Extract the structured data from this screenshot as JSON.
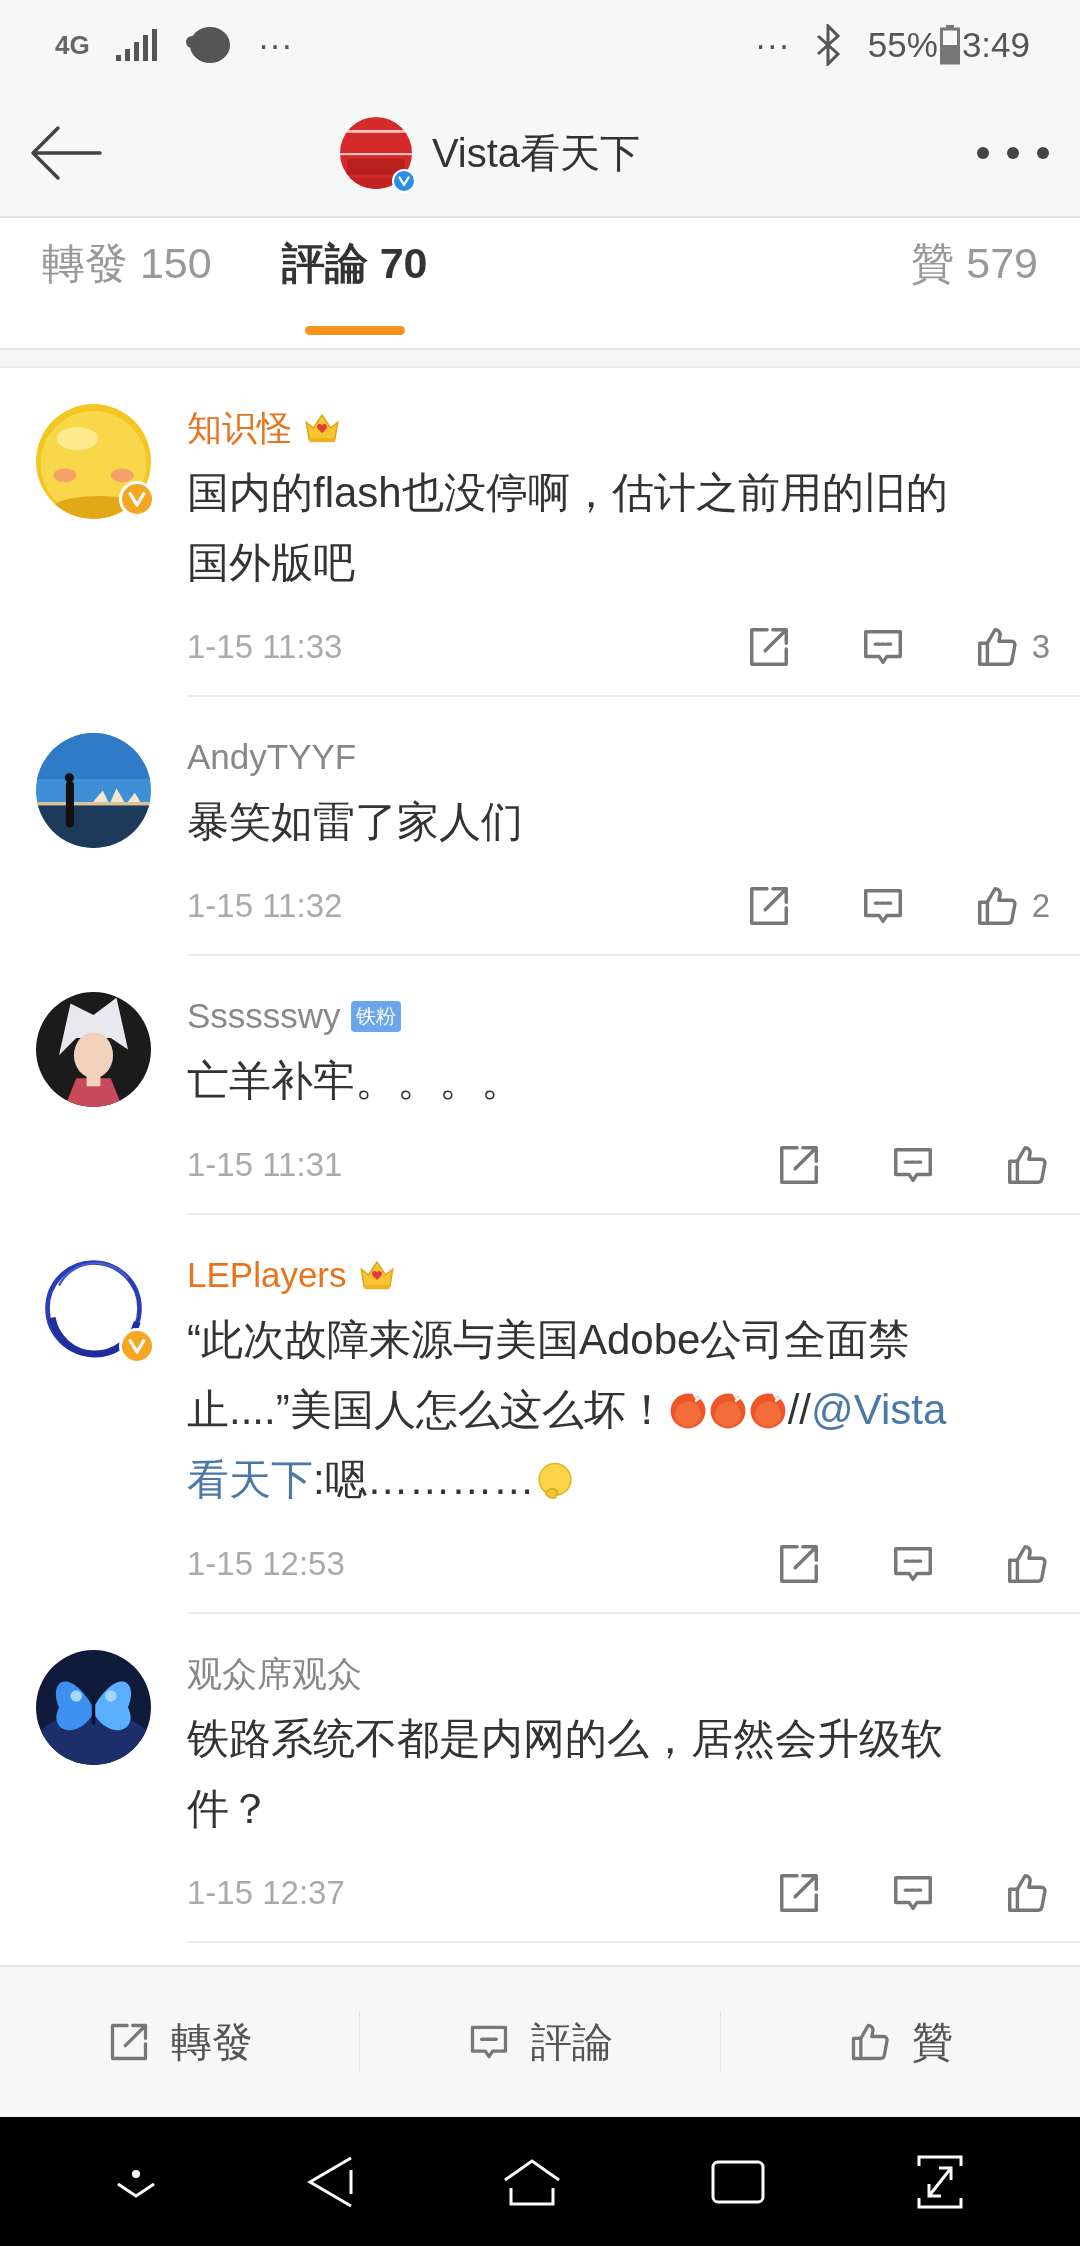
{
  "status_bar": {
    "network": "4G",
    "left_more": "···",
    "right_more": "···",
    "battery": "55%",
    "time": "3:49"
  },
  "header": {
    "title": "Vista看天下",
    "verified": true
  },
  "tabs": [
    {
      "label": "轉發 150",
      "selected": false
    },
    {
      "label": "評論 70",
      "selected": true
    },
    {
      "label": "贊 579",
      "selected": false
    }
  ],
  "comments": [
    {
      "name": "知识怪",
      "vip": true,
      "verified": true,
      "segments": [
        {
          "kind": "text",
          "text": "国内的flash也没停啊，估计之前用的旧的国外版吧"
        }
      ],
      "time": "1-15 11:33",
      "likes": "3"
    },
    {
      "name": "AndyTYYF",
      "vip": false,
      "verified": false,
      "segments": [
        {
          "kind": "text",
          "text": "暴笑如雷了家人们"
        }
      ],
      "time": "1-15 11:32",
      "likes": "2"
    },
    {
      "name": "Sssssswy",
      "vip": false,
      "verified": false,
      "badge": "铁粉",
      "segments": [
        {
          "kind": "text",
          "text": "亡羊补牢。。。。"
        }
      ],
      "time": "1-15 11:31"
    },
    {
      "name": "LEPlayers",
      "vip": true,
      "verified": true,
      "segments": [
        {
          "kind": "text",
          "text": "“此次故障来源与美国Adobe公司全面禁止....”美国人怎么这么坏！"
        },
        {
          "kind": "angry"
        },
        {
          "kind": "angry"
        },
        {
          "kind": "angry"
        },
        {
          "kind": "text",
          "text": "//"
        },
        {
          "kind": "link",
          "text": "@Vista"
        },
        {
          "kind": "link",
          "text": "看天下"
        },
        {
          "kind": "text",
          "text": ":嗯…………"
        },
        {
          "kind": "thinking"
        }
      ],
      "time": "1-15 12:53"
    },
    {
      "name": "观众席观众",
      "vip": false,
      "verified": false,
      "segments": [
        {
          "kind": "text",
          "text": "铁路系统不都是内网的么，居然会升级软件？"
        }
      ],
      "time": "1-15 12:37"
    }
  ],
  "bottom_bar": [
    {
      "kind": "repost",
      "label": "轉發"
    },
    {
      "kind": "comment",
      "label": "評論"
    },
    {
      "kind": "like",
      "label": "贊"
    }
  ]
}
